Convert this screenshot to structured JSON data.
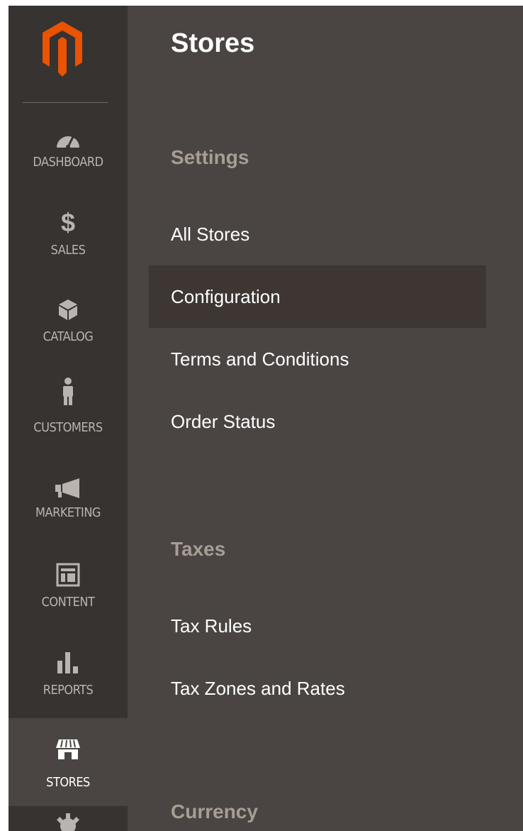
{
  "sidebar": {
    "items": [
      {
        "label": "DASHBOARD",
        "icon": "speedometer-icon"
      },
      {
        "label": "SALES",
        "icon": "dollar-icon"
      },
      {
        "label": "CATALOG",
        "icon": "cube-icon"
      },
      {
        "label": "CUSTOMERS",
        "icon": "person-icon"
      },
      {
        "label": "MARKETING",
        "icon": "megaphone-icon"
      },
      {
        "label": "CONTENT",
        "icon": "layout-icon"
      },
      {
        "label": "REPORTS",
        "icon": "bar-chart-icon"
      },
      {
        "label": "STORES",
        "icon": "storefront-icon"
      }
    ],
    "active": "STORES"
  },
  "submenu": {
    "title": "Stores",
    "groups": [
      {
        "title": "Settings",
        "links": [
          "All Stores",
          "Configuration",
          "Terms and Conditions",
          "Order Status"
        ]
      },
      {
        "title": "Taxes",
        "links": [
          "Tax Rules",
          "Tax Zones and Rates"
        ]
      },
      {
        "title": "Currency",
        "links": []
      }
    ],
    "highlighted_link": "Configuration"
  },
  "colors": {
    "sidebar_bg": "#373330",
    "panel_bg": "#4a4542",
    "accent_orange": "#eb5202",
    "group_title": "#a79d95",
    "highlight_bg": "#3d3633"
  }
}
